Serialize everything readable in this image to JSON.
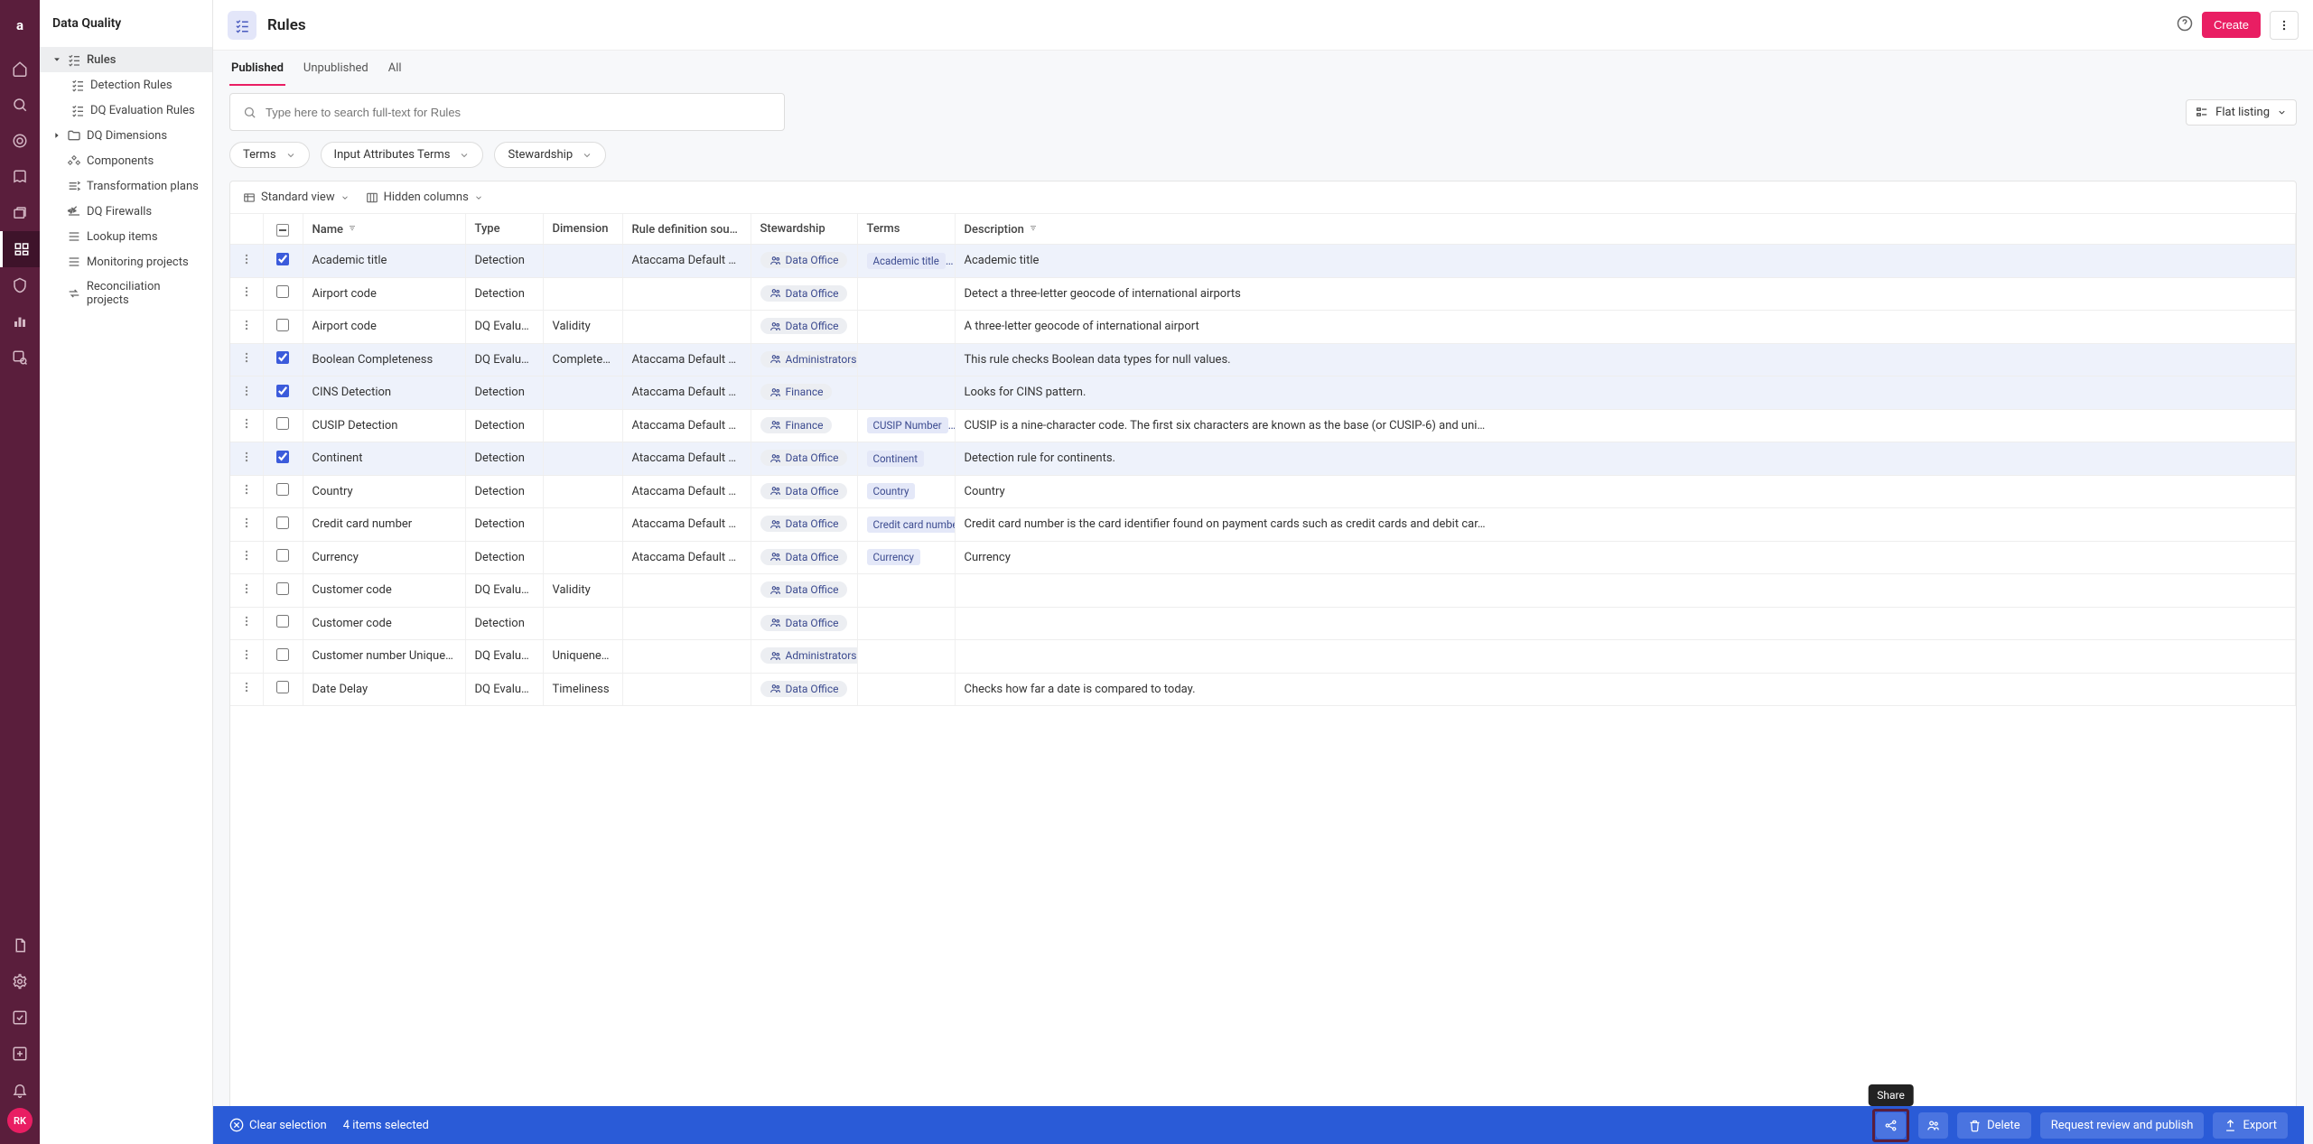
{
  "app": {
    "logo": "a",
    "avatar_initials": "RK"
  },
  "sidebar": {
    "title": "Data Quality",
    "items": [
      {
        "label": "Rules",
        "active": true,
        "hasChildren": true,
        "children": [
          {
            "label": "Detection Rules"
          },
          {
            "label": "DQ Evaluation Rules"
          }
        ]
      },
      {
        "label": "DQ Dimensions",
        "hasChildren": true
      },
      {
        "label": "Components"
      },
      {
        "label": "Transformation plans"
      },
      {
        "label": "DQ Firewalls"
      },
      {
        "label": "Lookup items"
      },
      {
        "label": "Monitoring projects"
      },
      {
        "label": "Reconciliation projects"
      }
    ]
  },
  "header": {
    "title": "Rules",
    "help_tooltip": "Help",
    "create_label": "Create",
    "more_label": "More"
  },
  "tabs": [
    {
      "label": "Published",
      "active": true
    },
    {
      "label": "Unpublished"
    },
    {
      "label": "All"
    }
  ],
  "search": {
    "placeholder": "Type here to search full-text for Rules"
  },
  "view": {
    "label": "Flat listing"
  },
  "filters": [
    {
      "label": "Terms"
    },
    {
      "label": "Input Attributes Terms"
    },
    {
      "label": "Stewardship"
    }
  ],
  "tableToolbar": {
    "view_label": "Standard view",
    "hidden_label": "Hidden columns"
  },
  "columns": {
    "name": "Name",
    "type": "Type",
    "dimension": "Dimension",
    "source": "Rule definition source",
    "stewardship": "Stewardship",
    "terms": "Terms",
    "description": "Description"
  },
  "rows": [
    {
      "sel": true,
      "name": "Academic title",
      "type": "Detection",
      "dim": "",
      "src": "Ataccama Default Rules",
      "stew": "Data Office",
      "term": "Academic title",
      "desc": "Academic title"
    },
    {
      "sel": false,
      "name": "Airport code",
      "type": "Detection",
      "dim": "",
      "src": "",
      "stew": "Data Office",
      "term": "",
      "desc": "Detect a three-letter geocode of international airports"
    },
    {
      "sel": false,
      "name": "Airport code",
      "type": "DQ Evaluation",
      "dim": "Validity",
      "src": "",
      "stew": "Data Office",
      "term": "",
      "desc": "A three-letter geocode of international airport"
    },
    {
      "sel": true,
      "name": "Boolean Completeness",
      "type": "DQ Evaluation",
      "dim": "Completeness",
      "src": "Ataccama Default Rules",
      "stew": "Administrators",
      "term": "",
      "desc": "This rule checks Boolean data types for null values."
    },
    {
      "sel": true,
      "name": "CINS Detection",
      "type": "Detection",
      "dim": "",
      "src": "Ataccama Default Rules",
      "stew": "Finance",
      "term": "",
      "desc": "Looks for CINS pattern."
    },
    {
      "sel": false,
      "name": "CUSIP Detection",
      "type": "Detection",
      "dim": "",
      "src": "Ataccama Default Rules",
      "stew": "Finance",
      "term": "CUSIP Number",
      "desc": "CUSIP is a nine-character code. The first six characters are known as the base (or CUSIP-6) and uni…"
    },
    {
      "sel": true,
      "name": "Continent",
      "type": "Detection",
      "dim": "",
      "src": "Ataccama Default Rules",
      "stew": "Data Office",
      "term": "Continent",
      "desc": "Detection rule for continents."
    },
    {
      "sel": false,
      "name": "Country",
      "type": "Detection",
      "dim": "",
      "src": "Ataccama Default Rules",
      "stew": "Data Office",
      "term": "Country",
      "desc": "Country"
    },
    {
      "sel": false,
      "name": "Credit card number",
      "type": "Detection",
      "dim": "",
      "src": "Ataccama Default Rules",
      "stew": "Data Office",
      "term": "Credit card number",
      "desc": "Credit card number is the card identifier found on payment cards such as credit cards and debit car…"
    },
    {
      "sel": false,
      "name": "Currency",
      "type": "Detection",
      "dim": "",
      "src": "Ataccama Default Rules",
      "stew": "Data Office",
      "term": "Currency",
      "desc": "Currency"
    },
    {
      "sel": false,
      "name": "Customer code",
      "type": "DQ Evaluation",
      "dim": "Validity",
      "src": "",
      "stew": "Data Office",
      "term": "",
      "desc": ""
    },
    {
      "sel": false,
      "name": "Customer code",
      "type": "Detection",
      "dim": "",
      "src": "",
      "stew": "Data Office",
      "term": "",
      "desc": ""
    },
    {
      "sel": false,
      "name": "Customer number Uniqueness",
      "type": "DQ Evaluation",
      "dim": "Uniqueness",
      "src": "",
      "stew": "Administrators",
      "term": "",
      "desc": ""
    },
    {
      "sel": false,
      "name": "Date Delay",
      "type": "DQ Evaluation",
      "dim": "Timeliness",
      "src": "",
      "stew": "Data Office",
      "term": "",
      "desc": "Checks how far a date is compared to today."
    }
  ],
  "bottomBar": {
    "clear_label": "Clear selection",
    "count_label": "4 items selected",
    "share_tooltip": "Share",
    "delete_label": "Delete",
    "review_label": "Request review and publish",
    "export_label": "Export"
  }
}
